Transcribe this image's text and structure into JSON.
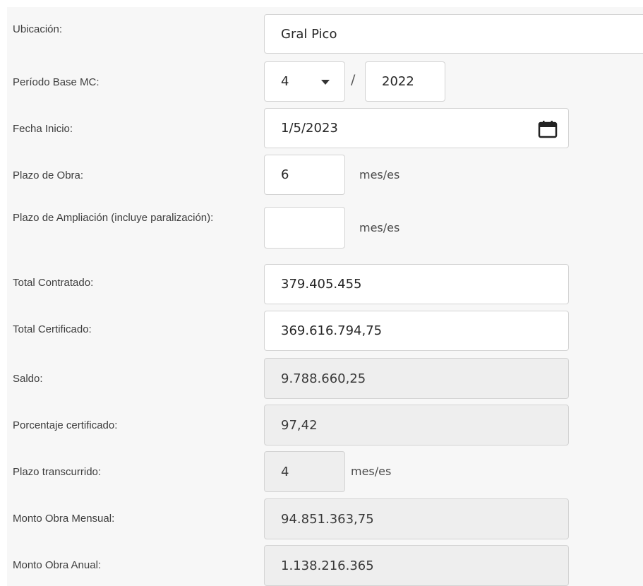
{
  "form": {
    "ubicacion": {
      "label": "Ubicación:",
      "value": "Gral Pico"
    },
    "periodo_base": {
      "label": "Período Base MC:",
      "month": "4",
      "separator": "/",
      "year": "2022"
    },
    "fecha_inicio": {
      "label": "Fecha Inicio:",
      "value": "1/5/2023"
    },
    "plazo_obra": {
      "label": "Plazo de Obra:",
      "value": "6",
      "unit": "mes/es"
    },
    "plazo_ampliacion": {
      "label": "Plazo de Ampliación (incluye paralización):",
      "value": "",
      "unit": "mes/es"
    },
    "total_contratado": {
      "label": "Total Contratado:",
      "value": "379.405.455"
    },
    "total_certificado": {
      "label": "Total Certificado:",
      "value": "369.616.794,75"
    },
    "saldo": {
      "label": "Saldo:",
      "value": "9.788.660,25"
    },
    "porcentaje_certificado": {
      "label": "Porcentaje certificado:",
      "value": "97,42"
    },
    "plazo_transcurrido": {
      "label": "Plazo transcurrido:",
      "value": "4",
      "unit": "mes/es"
    },
    "monto_obra_mensual": {
      "label": "Monto Obra Mensual:",
      "value": "94.851.363,75"
    },
    "monto_obra_anual": {
      "label": "Monto Obra Anual:",
      "value": "1.138.216.365"
    }
  },
  "icons": {
    "calendar": "calendar-icon",
    "dropdown": "chevron-down-icon"
  },
  "colors": {
    "panel_bg": "#f7f7f7",
    "input_bg": "#ffffff",
    "readonly_bg": "#eeeeee",
    "border": "#d3d3d3",
    "label_text": "#3d3d3d"
  }
}
